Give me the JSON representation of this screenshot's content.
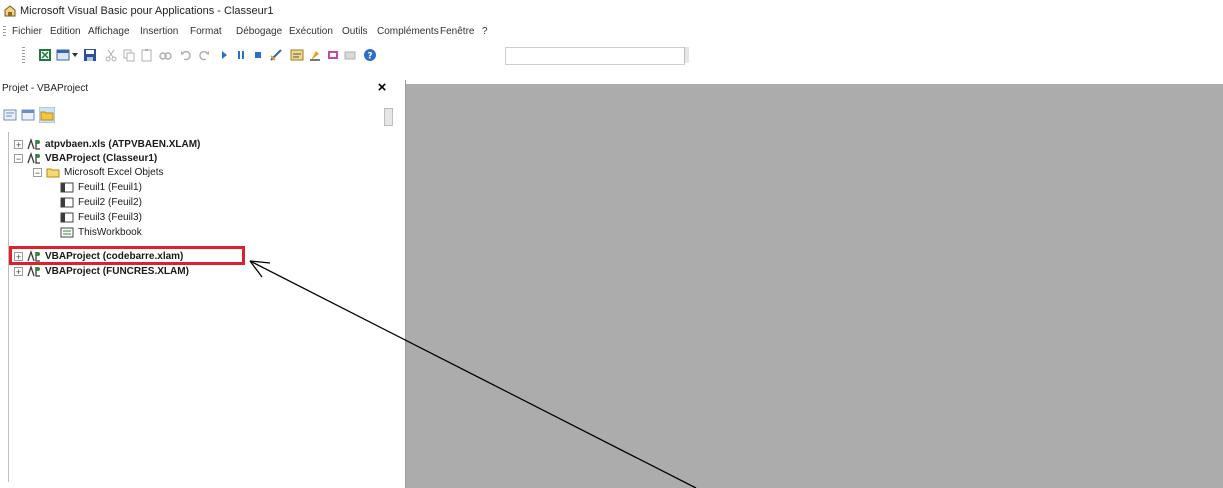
{
  "window": {
    "title": "Microsoft Visual Basic pour Applications - Classeur1"
  },
  "menu": [
    "Fichier",
    "Edition",
    "Affichage",
    "Insertion",
    "Format",
    "Débogage",
    "Exécution",
    "Outils",
    "Compléments",
    "Fenêtre",
    "?"
  ],
  "project_pane": {
    "title": "Projet - VBAProject",
    "close": "×"
  },
  "tree": {
    "atpvbaen": "atpvbaen.xls (ATPVBAEN.XLAM)",
    "vbaproject_classeur": "VBAProject (Classeur1)",
    "excel_objects": "Microsoft Excel Objets",
    "feuil1": "Feuil1 (Feuil1)",
    "feuil2": "Feuil2 (Feuil2)",
    "feuil3": "Feuil3 (Feuil3)",
    "thisworkbook": "ThisWorkbook",
    "codebarre": "VBAProject (codebarre.xlam)",
    "funcres": "VBAProject (FUNCRES.XLAM)"
  },
  "expanders": {
    "plus": "+",
    "minus": "−"
  },
  "colors": {
    "highlight": "#e0202a",
    "code_area": "#acacac"
  }
}
